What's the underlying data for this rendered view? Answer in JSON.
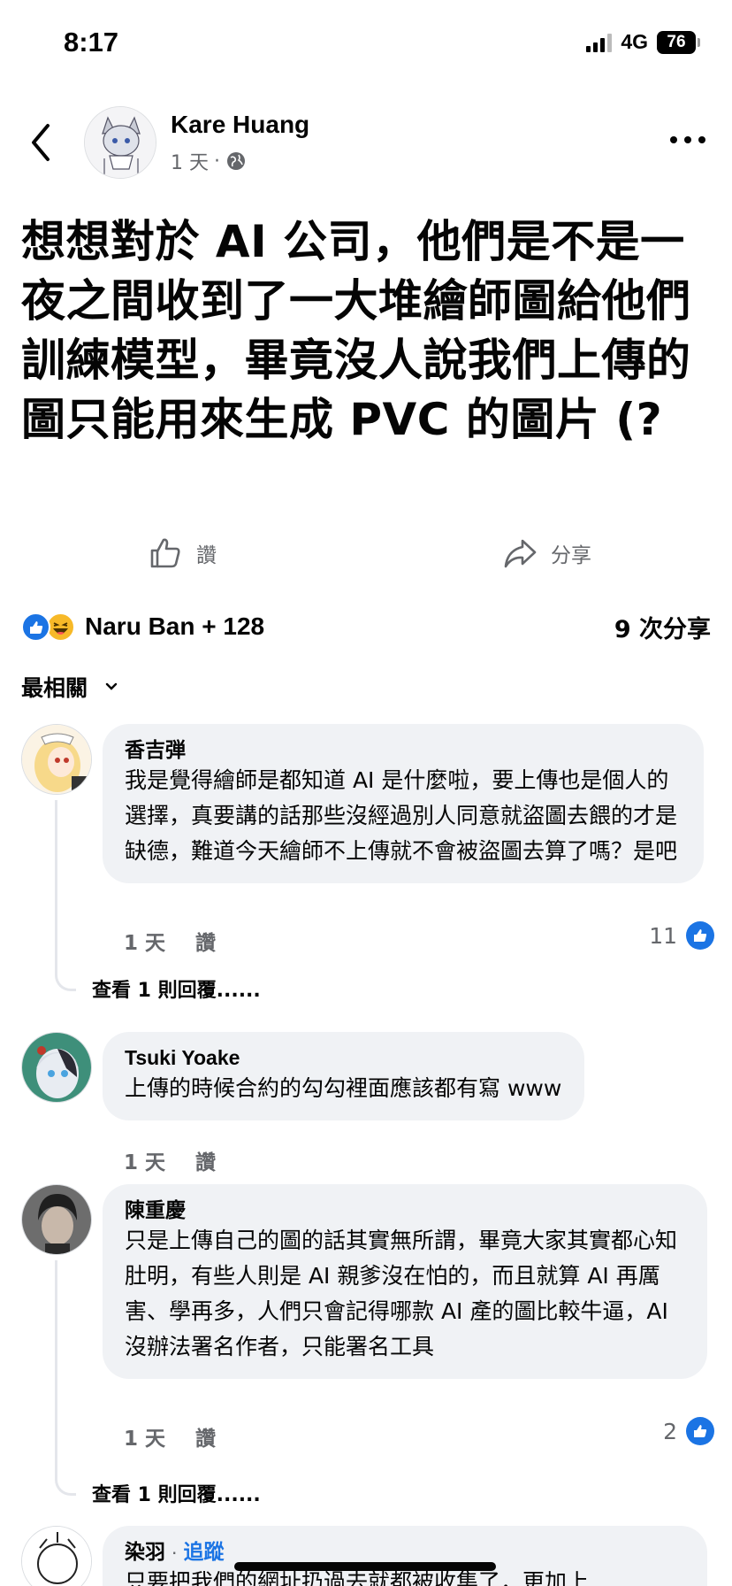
{
  "status_bar": {
    "time": "8:17",
    "network": "4G",
    "battery": "76"
  },
  "post": {
    "author": "Kare Huang",
    "time": "1 天",
    "separator": "·",
    "text": "想想對於 AI 公司，他們是不是一夜之間收到了一大堆繪師圖給他們訓練模型，畢竟沒人說我們上傳的圖只能用來生成 PVC 的圖片 (?",
    "like_label": "讚",
    "share_label": "分享",
    "reactions_text": "Naru Ban + 128",
    "shares_text": "9 次分享"
  },
  "sort": {
    "label": "最相關"
  },
  "comments": [
    {
      "name": "香吉弾",
      "text": "我是覺得繪師是都知道 AI 是什麼啦，要上傳也是個人的選擇，真要講的話那些沒經過別人同意就盜圖去餵的才是缺德，難道今天繪師不上傳就不會被盜圖去算了嗎？是吧",
      "time": "1 天",
      "like": "讚",
      "likes": "11",
      "replies": "查看 1 則回覆......"
    },
    {
      "name": "Tsuki Yoake",
      "text": "上傳的時候合約的勾勾裡面應該都有寫 www",
      "time": "1 天",
      "like": "讚"
    },
    {
      "name": "陳重慶",
      "text": "只是上傳自己的圖的話其實無所謂，畢竟大家其實都心知肚明，有些人則是 AI 親爹沒在怕的，而且就算 AI 再厲害、學再多，人們只會記得哪款 AI 產的圖比較牛逼，AI 沒辦法署名作者，只能署名工具",
      "time": "1 天",
      "like": "讚",
      "likes": "2",
      "replies": "查看 1 則回覆......"
    },
    {
      "name": "染羽",
      "separator": "·",
      "follow": "追蹤",
      "text": "只要把我們的網址扔過去就都被收集了，更加上"
    }
  ]
}
